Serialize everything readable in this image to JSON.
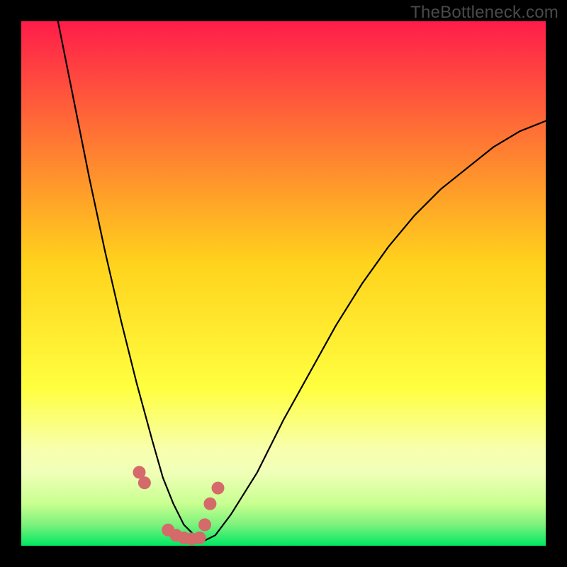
{
  "watermark": "TheBottleneck.com",
  "chart_data": {
    "type": "line",
    "title": "",
    "xlabel": "",
    "ylabel": "",
    "xlim": [
      0,
      100
    ],
    "ylim": [
      0,
      100
    ],
    "note": "No axes, ticks, or numeric labels are visible; curve values are estimated from pixel positions on a normalized 0-100 grid.",
    "series": [
      {
        "name": "bottleneck-curve",
        "x": [
          7,
          10,
          13,
          16,
          19,
          22,
          25,
          27,
          29,
          31,
          33,
          35,
          37,
          40,
          45,
          50,
          55,
          60,
          65,
          70,
          75,
          80,
          85,
          90,
          95,
          100
        ],
        "y": [
          100,
          85,
          70,
          56,
          43,
          31,
          20,
          13,
          8,
          4,
          2,
          1,
          2,
          6,
          14,
          24,
          33,
          42,
          50,
          57,
          63,
          68,
          72,
          76,
          79,
          81
        ]
      }
    ],
    "markers": {
      "name": "highlighted-points",
      "color": "#d46a6a",
      "x": [
        22.5,
        23.5,
        28.0,
        29.5,
        31.0,
        32.5,
        34.0,
        35.0,
        36.0,
        37.5
      ],
      "y": [
        14.0,
        12.0,
        3.0,
        2.0,
        1.5,
        1.3,
        1.5,
        4.0,
        8.0,
        11.0
      ]
    },
    "background_bands": [
      {
        "y_from": 84,
        "y_to": 100,
        "color_top": "#ff1c4a",
        "color_bottom": "#ff5d3a"
      },
      {
        "y_from": 48,
        "y_to": 84,
        "color_top": "#ff5d3a",
        "color_bottom": "#ffd21c"
      },
      {
        "y_from": 14,
        "y_to": 48,
        "color_top": "#ffd21c",
        "color_bottom": "#f9ff5c"
      },
      {
        "y_from": 5,
        "y_to": 14,
        "color_top": "#f9ff5c",
        "color_bottom": "#c8ff90"
      },
      {
        "y_from": 0,
        "y_to": 5,
        "color_top": "#c8ff90",
        "color_bottom": "#00e763"
      }
    ]
  }
}
